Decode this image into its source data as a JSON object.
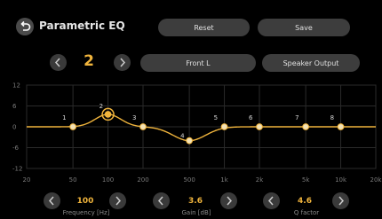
{
  "header": {
    "title": "Parametric EQ",
    "reset_label": "Reset",
    "save_label": "Save"
  },
  "band_selector": {
    "current": "2",
    "channel_label": "Front L",
    "output_label": "Speaker Output"
  },
  "graph": {
    "y_ticks": [
      "12",
      "6",
      "0",
      "-6",
      "-12"
    ],
    "x_ticks": [
      "20",
      "50",
      "100",
      "200",
      "500",
      "1k",
      "2k",
      "5k",
      "10k",
      "20k"
    ],
    "bands": [
      {
        "label": "1",
        "freq": 50,
        "gain": 0
      },
      {
        "label": "2",
        "freq": 100,
        "gain": 3.6,
        "selected": true
      },
      {
        "label": "3",
        "freq": 200,
        "gain": 0
      },
      {
        "label": "4",
        "freq": 500,
        "gain": -4
      },
      {
        "label": "5",
        "freq": 1000,
        "gain": 0
      },
      {
        "label": "6",
        "freq": 2000,
        "gain": 0
      },
      {
        "label": "7",
        "freq": 5000,
        "gain": 0
      },
      {
        "label": "8",
        "freq": 10000,
        "gain": 0
      }
    ],
    "curve_color": "#f0b43c"
  },
  "controls": {
    "frequency": {
      "value": "100",
      "label": "Frequency [Hz]"
    },
    "gain": {
      "value": "3.6",
      "label": "Gain [dB]"
    },
    "q": {
      "value": "4.6",
      "label": "Q factor"
    }
  }
}
